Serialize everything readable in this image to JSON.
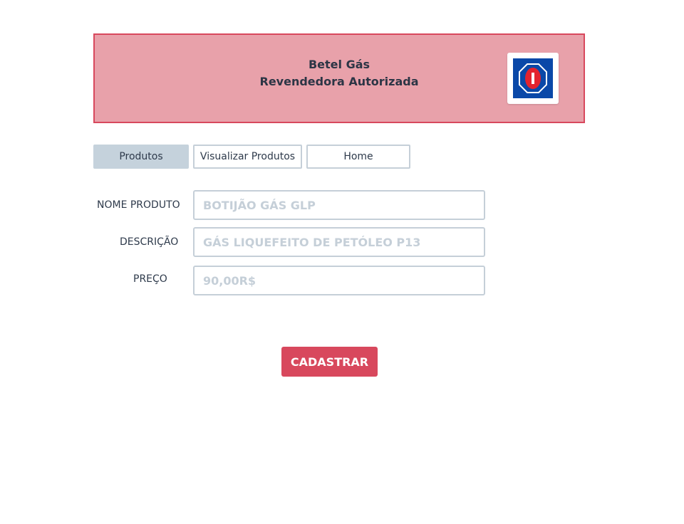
{
  "header": {
    "title": "Betel Gás",
    "subtitle": "Revendedora Autorizada",
    "logo": "gas-brand-logo",
    "colors": {
      "background": "#e8a1aa",
      "border": "#d8485d",
      "logo_blue": "#0a48a8",
      "logo_red": "#e3232e"
    }
  },
  "nav": {
    "tabs": [
      {
        "label": "Produtos",
        "active": true
      },
      {
        "label": "Visualizar Produtos",
        "active": false
      },
      {
        "label": "Home",
        "active": false
      }
    ]
  },
  "form": {
    "name": {
      "label": "NOME PRODUTO",
      "placeholder": "BOTIJÃO GÁS GLP",
      "value": ""
    },
    "description": {
      "label": "DESCRIÇÃO",
      "placeholder": "GÁS LIQUEFEITO DE PETÓLEO P13",
      "value": ""
    },
    "price": {
      "label": "PREÇO",
      "placeholder": "90,00R$",
      "value": ""
    },
    "submit_label": "CADASTRAR",
    "colors": {
      "button": "#d8485d",
      "field_border": "#c5cfd8"
    }
  }
}
